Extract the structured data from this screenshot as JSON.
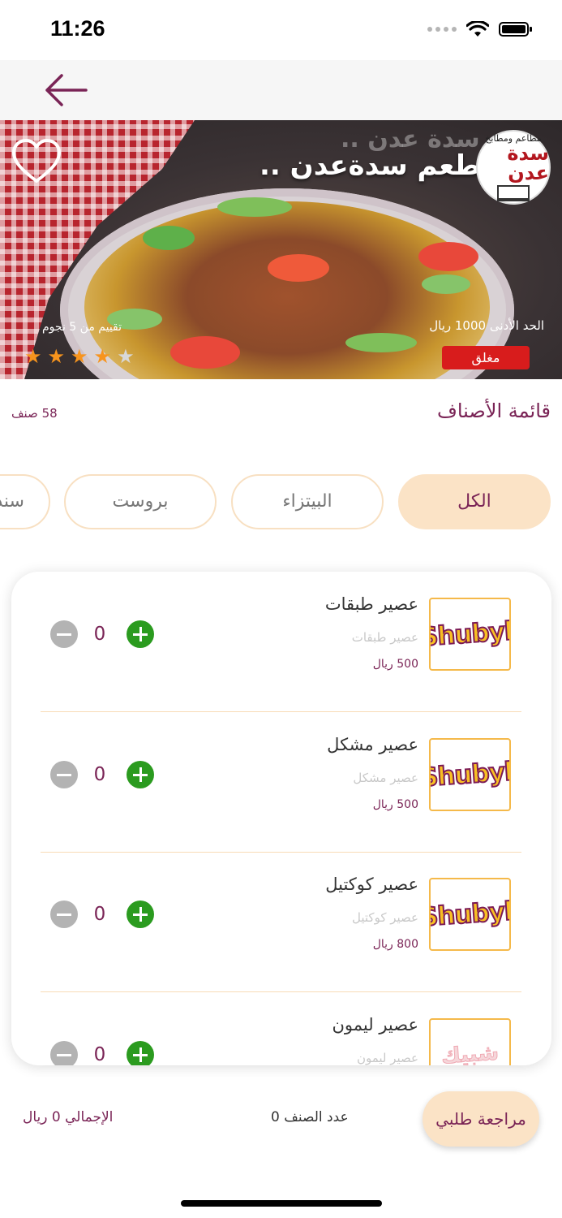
{
  "status_bar": {
    "time": "11:26"
  },
  "hero": {
    "restaurant_name": "مطعم سدةعدن ..",
    "banner_text": "سدة عدن ..",
    "logo_top": "مطاعم ومطابخ",
    "logo_name": "سدة عدن",
    "rating_label": "تقييم من 5 نجوم",
    "rating_value": 4,
    "rating_max": 5,
    "min_order": "الحد الأدنى 1000 ريال",
    "status": "مغلق"
  },
  "categories": {
    "title": "قائمة الأصناف",
    "count": "58 صنف",
    "chips": [
      {
        "label": "الكل",
        "active": true
      },
      {
        "label": "البيتزاء",
        "active": false
      },
      {
        "label": "بروست",
        "active": false
      },
      {
        "label": "سندوتشات",
        "active": false
      }
    ]
  },
  "items": [
    {
      "name": "عصير طبقات",
      "desc": "عصير طبقات",
      "price": "500 ريال",
      "qty": "0",
      "thumb": "Shubyk"
    },
    {
      "name": "عصير مشكل",
      "desc": "عصير مشكل",
      "price": "500 ريال",
      "qty": "0",
      "thumb": "Shubyk"
    },
    {
      "name": "عصير كوكتيل",
      "desc": "عصير كوكتيل",
      "price": "800 ريال",
      "qty": "0",
      "thumb": "Shubyk"
    },
    {
      "name": "عصير ليمون",
      "desc": "عصير ليمون",
      "price": "",
      "qty": "0",
      "thumb": "شبيك"
    }
  ],
  "footer": {
    "review_label": "مراجعة طلبي",
    "item_count": "عدد الصنف 0",
    "total": "الإجمالي 0 ريال"
  },
  "colors": {
    "accent": "#7a2456",
    "chip_active": "#fbe3c6",
    "closed_badge": "#d81c1c",
    "plus": "#2b9b1f",
    "minus": "#b3b3b3"
  }
}
